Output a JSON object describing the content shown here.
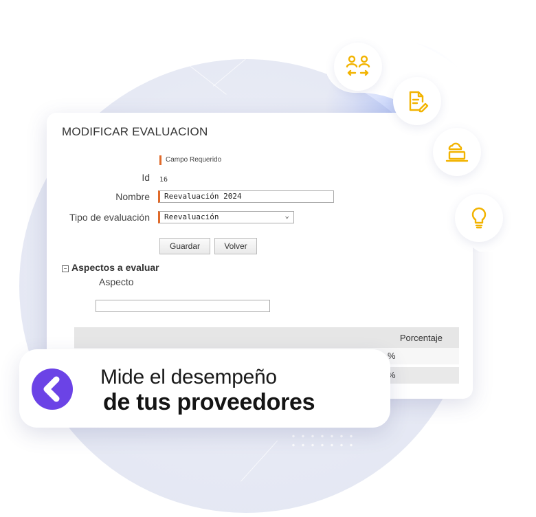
{
  "form": {
    "title": "MODIFICAR EVALUACION",
    "required_note": "Campo Requerido",
    "id_label": "Id",
    "id_value": "16",
    "name_label": "Nombre",
    "name_value": "Reevaluación 2024",
    "type_label": "Tipo de evaluación",
    "type_value": "Reevaluación",
    "save_label": "Guardar",
    "back_label": "Volver",
    "section_toggle": "⊟",
    "section_title": "Aspectos a evaluar",
    "aspect_label": "Aspecto",
    "aspect_value": "",
    "table_header": "Porcentaje",
    "rows": [
      "%",
      "%"
    ]
  },
  "banner": {
    "line1": "Mide el desempeño",
    "line2": "de tus proveedores"
  },
  "icons": [
    "people-exchange-icon",
    "document-edit-icon",
    "laptop-cloud-icon",
    "lightbulb-icon"
  ],
  "colors": {
    "accent_orange": "#f2b300",
    "brand_purple": "#6b43e6",
    "required_marker": "#e06a2a"
  }
}
